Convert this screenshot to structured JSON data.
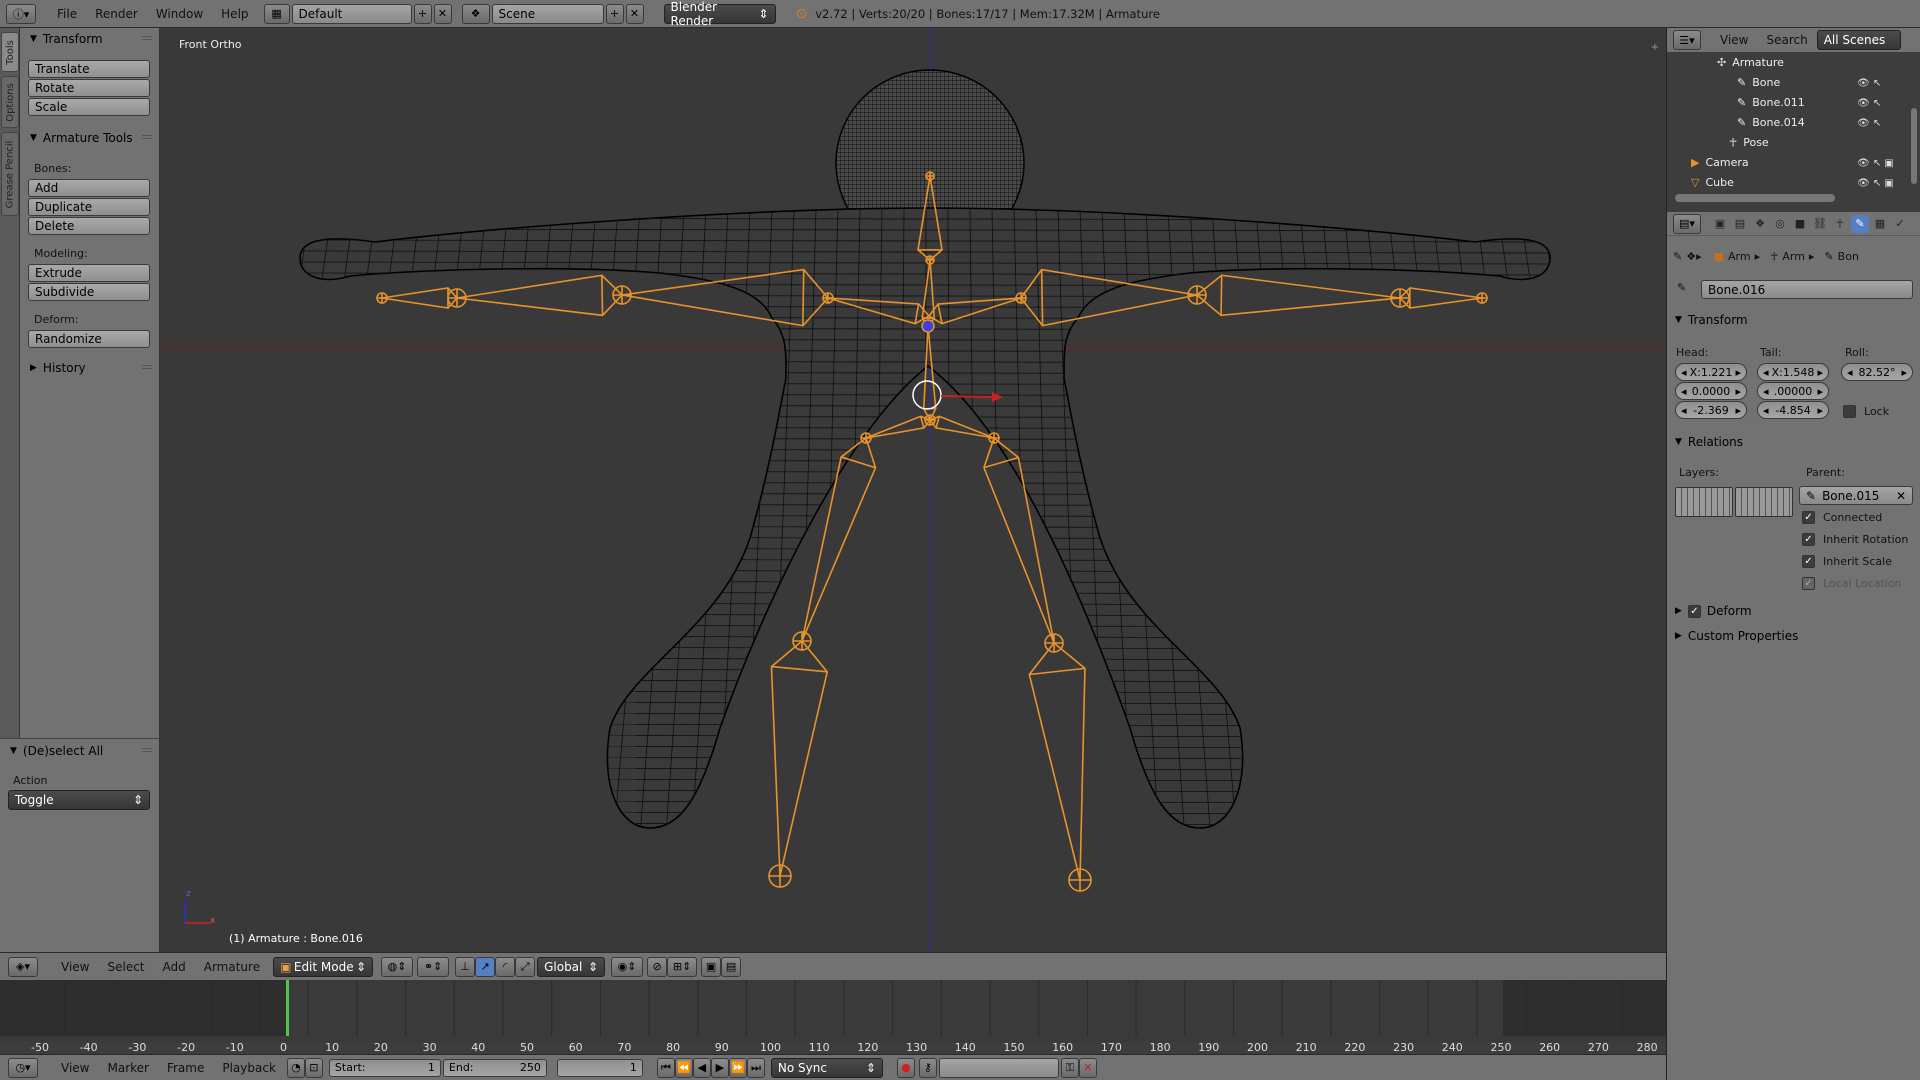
{
  "topbar": {
    "menus": [
      "File",
      "Render",
      "Window",
      "Help"
    ],
    "layout": "Default",
    "scene": "Scene",
    "engine": "Blender Render",
    "status": "v2.72 | Verts:20/20 | Bones:17/17 | Mem:17.32M | Armature"
  },
  "tabs": [
    "Tools",
    "Options",
    "Grease Pencil"
  ],
  "toolshelf": {
    "transform_title": "Transform",
    "transform_buttons": [
      "Translate",
      "Rotate",
      "Scale"
    ],
    "armature_title": "Armature Tools",
    "bones_label": "Bones:",
    "bones_buttons": [
      "Add",
      "Duplicate",
      "Delete"
    ],
    "modeling_label": "Modeling:",
    "modeling_buttons": [
      "Extrude",
      "Subdivide"
    ],
    "deform_label": "Deform:",
    "deform_button": "Randomize",
    "history_title": "History"
  },
  "operator": {
    "title": "(De)select All",
    "action_label": "Action",
    "action_value": "Toggle"
  },
  "viewport": {
    "view_name": "Front Ortho",
    "object_info": "(1) Armature : Bone.016",
    "axis_z": "z",
    "axis_x": "x"
  },
  "viewport_header": {
    "menus": [
      "View",
      "Select",
      "Add",
      "Armature"
    ],
    "mode": "Edit Mode",
    "orientation": "Global"
  },
  "timeline": {
    "ticks": [
      "-50",
      "-40",
      "-30",
      "-20",
      "-10",
      "0",
      "10",
      "20",
      "30",
      "40",
      "50",
      "60",
      "70",
      "80",
      "90",
      "100",
      "110",
      "120",
      "130",
      "140",
      "150",
      "160",
      "170",
      "180",
      "190",
      "200",
      "210",
      "220",
      "230",
      "240",
      "250",
      "260",
      "270",
      "280"
    ],
    "menus": [
      "View",
      "Marker",
      "Frame",
      "Playback"
    ],
    "start_label": "Start:",
    "start_value": "1",
    "end_label": "End:",
    "end_value": "250",
    "current_frame": "1",
    "sync": "No Sync"
  },
  "outliner": {
    "menus": [
      "View",
      "Search"
    ],
    "filter": "All Scenes",
    "rows": [
      "Armature",
      "Bone",
      "Bone.011",
      "Bone.014",
      "Pose",
      "Camera",
      "Cube"
    ]
  },
  "properties": {
    "breadcrumb": [
      "Arm",
      "Arm",
      "Bon"
    ],
    "bone_name": "Bone.016",
    "transform_title": "Transform",
    "head_label": "Head:",
    "tail_label": "Tail:",
    "roll_label": "Roll:",
    "head": [
      "X:1.221",
      "0.0000",
      "-2.369"
    ],
    "tail": [
      "X:1.548",
      ".00000",
      "-4.854"
    ],
    "roll": "82.52°",
    "lock_label": "Lock",
    "relations_title": "Relations",
    "layers_label": "Layers:",
    "parent_label": "Parent:",
    "parent_value": "Bone.015",
    "checks": [
      "Connected",
      "Inherit Rotation",
      "Inherit Scale",
      "Local Location"
    ],
    "deform_title": "Deform",
    "custom_title": "Custom Properties"
  },
  "colors": {
    "bone": "#e8932a",
    "mesh": "#0a0a0a",
    "axis_x": "#a01e1e",
    "axis_z": "#2a2acc",
    "frame_marker": "#4bc84b"
  }
}
